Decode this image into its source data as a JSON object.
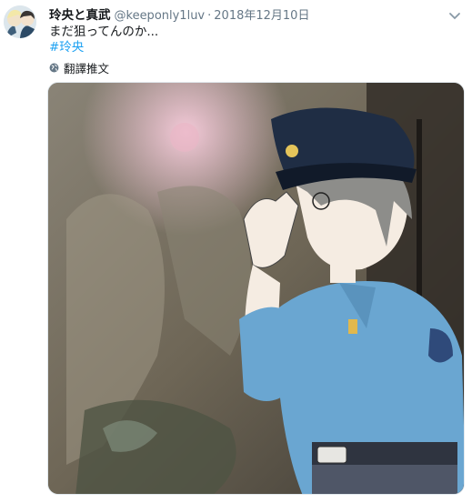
{
  "tweet": {
    "display_name": "玲央と真武",
    "handle": "@keeponly1luv",
    "separator": "·",
    "date": "2018年12月10日",
    "text": "まだ狙ってんのか...",
    "hashtag": "#玲央",
    "translate_label": "翻譯推文"
  },
  "icons": {
    "avatar": "avatar-illustration",
    "caret": "chevron-down-icon",
    "globe": "globe-icon"
  },
  "colors": {
    "link": "#1da1f2",
    "muted": "#657786",
    "text": "#14171a"
  }
}
